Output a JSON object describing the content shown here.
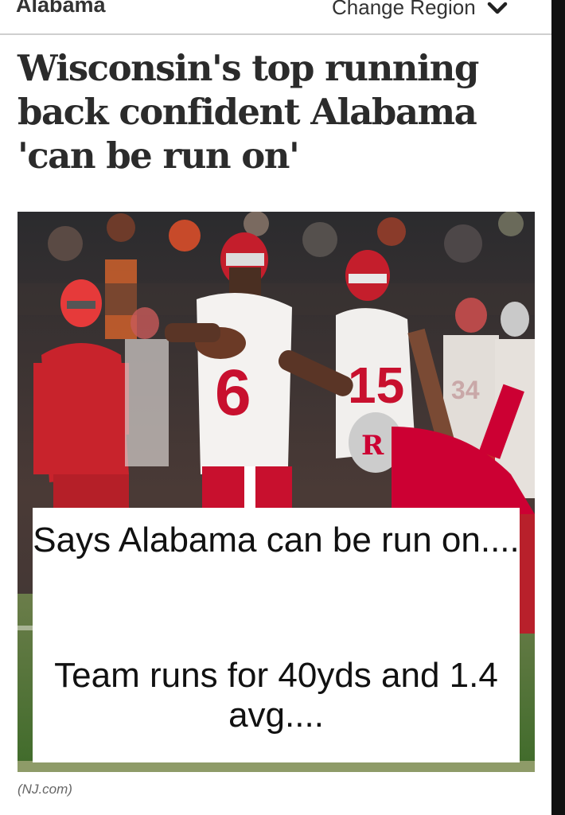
{
  "header": {
    "region_name": "Alabama",
    "change_region_label": "Change Region",
    "chevron_icon": "chevron-down-icon"
  },
  "article": {
    "headline": "Wisconsin's top running back confident Alabama 'can be run on'",
    "image": {
      "overlay_text_1": "Says Alabama can be run on....",
      "overlay_text_2": "Team runs for 40yds and 1.4 avg....",
      "jersey_numbers": [
        "6",
        "15"
      ]
    },
    "source": "(NJ.com)"
  },
  "colors": {
    "text_dark": "#2b2b2b",
    "wisconsin_red": "#c8102e",
    "rutgers_red": "#cc0033",
    "field_green": "#4f7a2f"
  }
}
